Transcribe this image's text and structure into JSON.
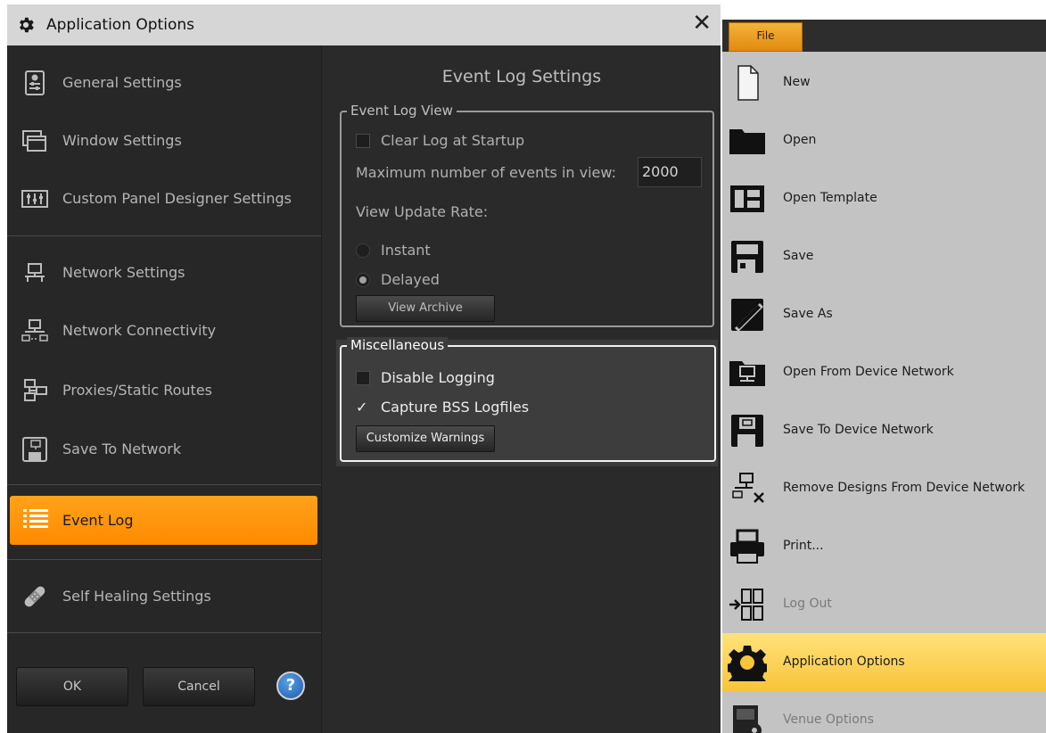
{
  "dialog": {
    "title": "Application Options",
    "close_glyph": "✕",
    "title_icon": "gear-icon"
  },
  "sidebar": {
    "items": [
      {
        "label": "General Settings",
        "icon": "general-settings-icon"
      },
      {
        "label": "Window Settings",
        "icon": "windows-icon"
      },
      {
        "label": "Custom Panel Designer Settings",
        "icon": "faders-icon"
      },
      {
        "label": "Network Settings",
        "icon": "network-icon"
      },
      {
        "label": "Network Connectivity",
        "icon": "network-connectivity-icon"
      },
      {
        "label": "Proxies/Static Routes",
        "icon": "proxies-icon"
      },
      {
        "label": "Save To Network",
        "icon": "save-to-network-icon"
      },
      {
        "label": "Event Log",
        "icon": "list-icon",
        "active": true
      },
      {
        "label": "Self Healing Settings",
        "icon": "bandage-icon"
      }
    ],
    "active_color": "#ff9a10"
  },
  "footer": {
    "ok_label": "OK",
    "cancel_label": "Cancel",
    "help_glyph": "?"
  },
  "main": {
    "title": "Event Log Settings",
    "event_log_view": {
      "legend": "Event Log View",
      "clear_log_label": "Clear Log at Startup",
      "clear_log_checked": false,
      "max_events_label": "Maximum number of events in view:",
      "max_events_value": "2000",
      "update_rate_label": "View Update Rate:",
      "instant_label": "Instant",
      "delayed_label": "Delayed",
      "selected_rate": "Delayed",
      "view_archive_label": "View Archive"
    },
    "misc": {
      "legend": "Miscellaneous",
      "disable_logging_label": "Disable Logging",
      "disable_logging_checked": false,
      "capture_label": "Capture BSS Logfiles",
      "capture_checked": true,
      "check_glyph": "✓",
      "customize_label": "Customize Warnings"
    }
  },
  "file_menu": {
    "tab_label": "File",
    "items": [
      {
        "label": "New",
        "icon": "new-document-icon"
      },
      {
        "label": "Open",
        "icon": "folder-icon"
      },
      {
        "label": "Open Template",
        "icon": "template-icon"
      },
      {
        "label": "Save",
        "icon": "floppy-disk-icon"
      },
      {
        "label": "Save As",
        "icon": "save-as-icon"
      },
      {
        "label": "Open From Device Network",
        "icon": "open-from-network-icon"
      },
      {
        "label": "Save To Device Network",
        "icon": "save-to-device-network-icon"
      },
      {
        "label": "Remove Designs From Device Network",
        "icon": "remove-from-network-icon"
      },
      {
        "label": "Print...",
        "icon": "printer-icon"
      },
      {
        "label": "Log Out",
        "icon": "log-out-icon",
        "disabled": true
      },
      {
        "label": "Application Options",
        "icon": "gear-icon",
        "highlighted": true
      },
      {
        "label": "Venue Options",
        "icon": "venue-options-icon",
        "disabled": true
      }
    ],
    "highlight_color": "#f8c43a"
  }
}
